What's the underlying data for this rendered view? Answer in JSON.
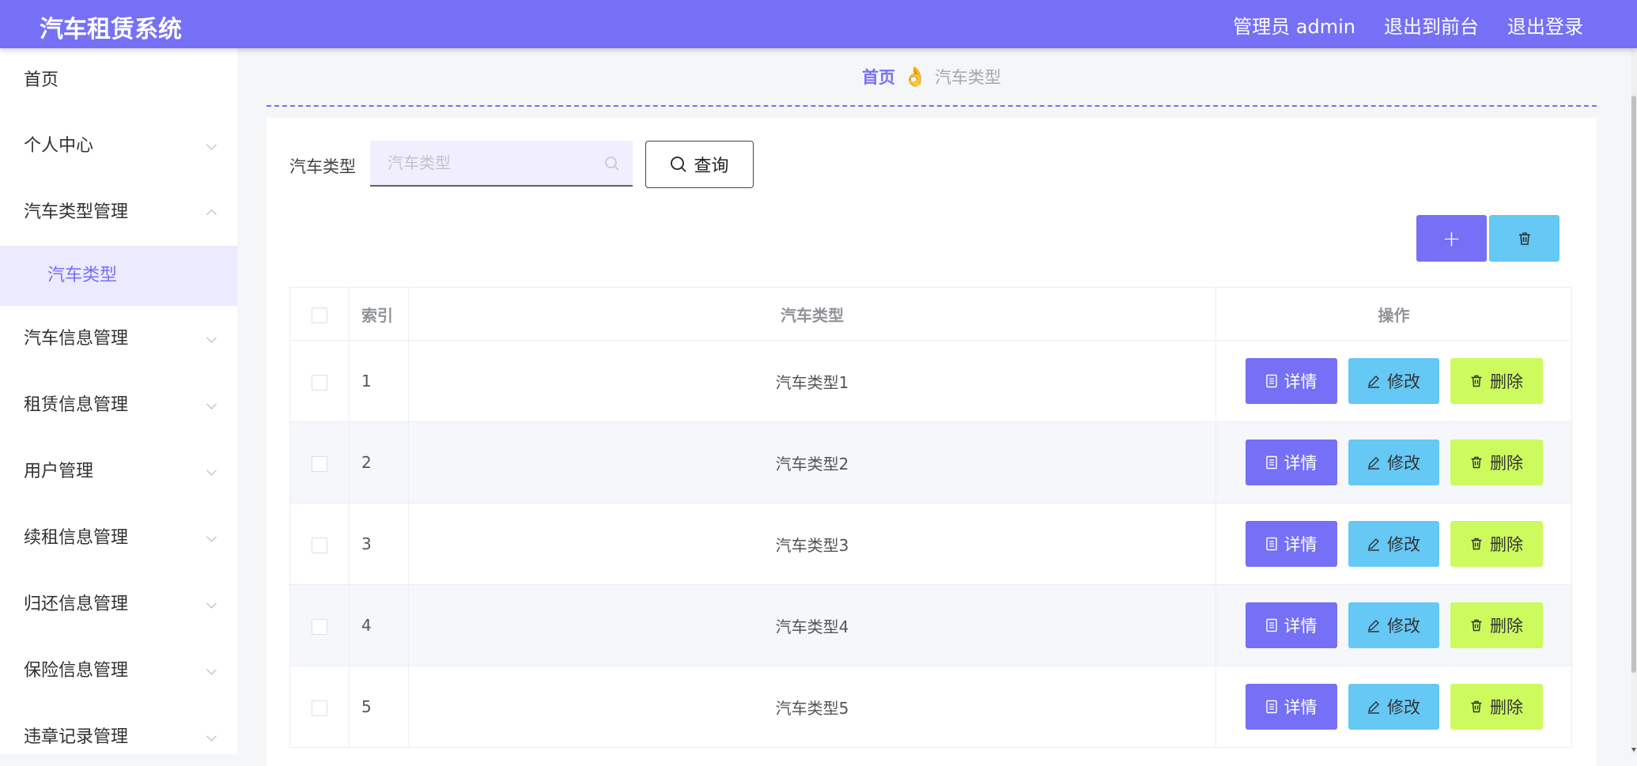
{
  "header": {
    "brand": "汽车租赁系统",
    "admin_label": "管理员 admin",
    "to_front": "退出到前台",
    "logout": "退出登录"
  },
  "sidebar": {
    "items": [
      {
        "label": "首页"
      },
      {
        "label": "个人中心"
      },
      {
        "label": "汽车类型管理"
      },
      {
        "label": "汽车类型"
      },
      {
        "label": "汽车信息管理"
      },
      {
        "label": "租赁信息管理"
      },
      {
        "label": "用户管理"
      },
      {
        "label": "续租信息管理"
      },
      {
        "label": "归还信息管理"
      },
      {
        "label": "保险信息管理"
      },
      {
        "label": "违章记录管理"
      }
    ]
  },
  "breadcrumb": {
    "home": "首页",
    "separator": "👌",
    "current": "汽车类型"
  },
  "search": {
    "label": "汽车类型",
    "placeholder": "汽车类型",
    "value": "",
    "button": "查询"
  },
  "actions": {
    "add_symbol": "+"
  },
  "table": {
    "headers": [
      "索引",
      "汽车类型",
      "操作"
    ],
    "rows": [
      {
        "index": "1",
        "type": "汽车类型1"
      },
      {
        "index": "2",
        "type": "汽车类型2"
      },
      {
        "index": "3",
        "type": "汽车类型3"
      },
      {
        "index": "4",
        "type": "汽车类型4"
      },
      {
        "index": "5",
        "type": "汽车类型5"
      }
    ],
    "ops": {
      "detail": "详情",
      "edit": "修改",
      "delete": "删除"
    }
  },
  "colors": {
    "primary": "#7570f5",
    "info": "#65c8f5",
    "danger_bg": "#cdfb5e"
  },
  "icons": [
    "search-icon",
    "trash-icon",
    "plus-icon",
    "document-icon",
    "pen-icon",
    "chevron-down-icon",
    "chevron-up-icon"
  ]
}
